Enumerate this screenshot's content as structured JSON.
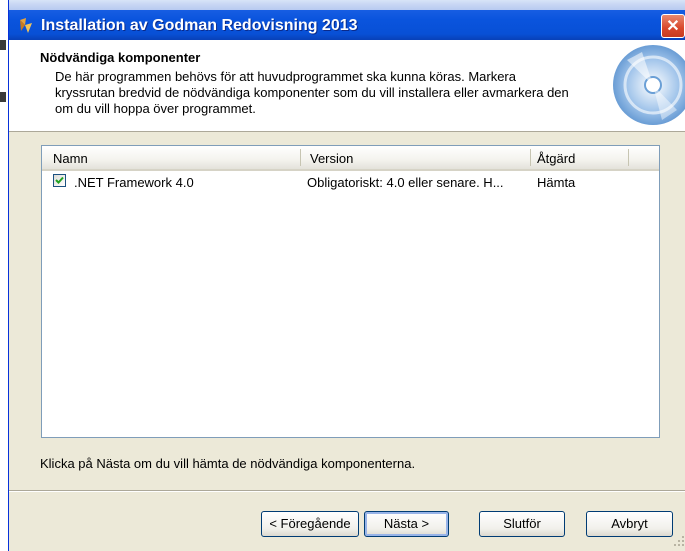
{
  "window": {
    "title": "Installation av Godman Redovisning 2013",
    "close_symbol": "✕"
  },
  "header": {
    "title": "Nödvändiga komponenter",
    "description": "De här programmen behövs för att huvudprogrammet ska kunna köras. Markera kryssrutan bredvid de nödvändiga komponenter som du vill installera eller avmarkera den om du vill hoppa över programmet."
  },
  "list": {
    "columns": [
      "Namn",
      "Version",
      "Åtgärd"
    ],
    "rows": [
      {
        "checked": true,
        "name": ".NET Framework 4.0",
        "version": "Obligatoriskt: 4.0 eller senare. H...",
        "action": "Hämta"
      }
    ]
  },
  "hint": "Klicka på Nästa om du vill hämta de nödvändiga komponenterna.",
  "buttons": {
    "back": "< Föregående",
    "next": "Nästa >",
    "finish": "Slutför",
    "cancel": "Avbryt"
  },
  "colors": {
    "titlebar": "#0a54dd",
    "dialog_face": "#ece9d8",
    "close_button": "#d9482c"
  },
  "icons": [
    "installer-icon",
    "close-icon",
    "checkmark-icon",
    "setup-disc-icon",
    "resize-grip-icon"
  ]
}
